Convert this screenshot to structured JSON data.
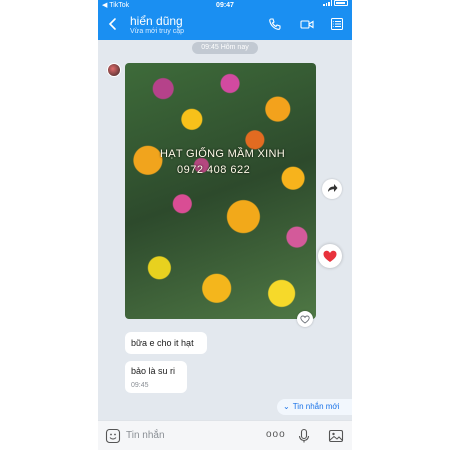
{
  "status_bar": {
    "carrier": "◀ TikTok",
    "time": "09:47"
  },
  "header": {
    "contact_name": "hiển dũng",
    "contact_status": "Vừa mới truy cập",
    "back_icon": "chevron-left-icon",
    "call_icon": "phone-icon",
    "video_icon": "video-camera-icon",
    "menu_icon": "list-menu-icon"
  },
  "chat": {
    "timestamp_pill": "09:45 Hôm nay",
    "image_watermark_line1": "HẠT GIỐNG MẦM XINH",
    "image_watermark_line2": "0972 408 622",
    "messages": [
      {
        "text": "bữa e cho it hạt"
      },
      {
        "text": "bảo là su ri",
        "time": "09:45"
      }
    ],
    "new_messages_label": "Tin nhắn mới"
  },
  "input_bar": {
    "placeholder": "Tin nhắn",
    "more_label": "ooo"
  },
  "colors": {
    "header_blue": "#1a8ff2",
    "chat_bg": "#e3e8ee",
    "heart_red": "#e8323c",
    "link_blue": "#1a73e8"
  }
}
